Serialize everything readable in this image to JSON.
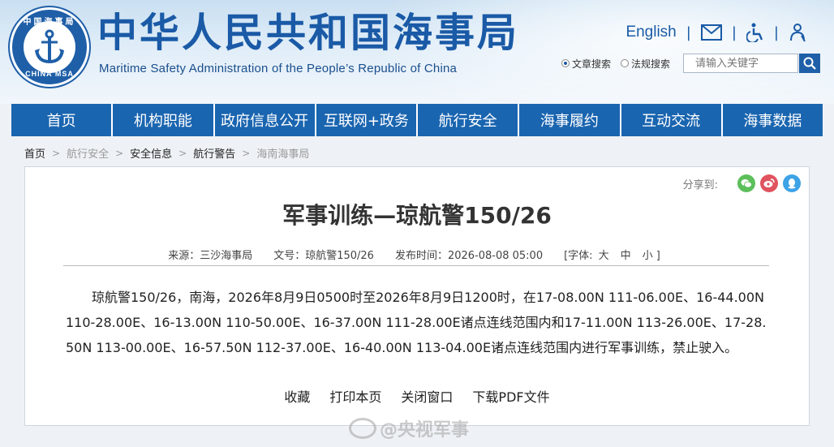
{
  "header": {
    "logo_top_text": "中国海事局",
    "logo_bottom_text": "CHINA MSA",
    "title": "中华人民共和国海事局",
    "subtitle": "Maritime Safety Administration of the People’s Republic of China",
    "english_link": "English",
    "search": {
      "option_article": "文章搜索",
      "option_law": "法规搜索",
      "placeholder": "请输入关键字"
    }
  },
  "nav": {
    "items": [
      "首页",
      "机构职能",
      "政府信息公开",
      "互联网+政务",
      "航行安全",
      "海事履约",
      "互动交流",
      "海事数据"
    ]
  },
  "breadcrumb": {
    "items": [
      "首页",
      "航行安全",
      "安全信息",
      "航行警告",
      "海南海事局"
    ],
    "separator": ">"
  },
  "article": {
    "share_label": "分享到:",
    "title": "军事训练—琼航警150/26",
    "meta": {
      "source": "来源：三沙海事局",
      "doc_no": "文号：琼航警150/26",
      "published": "发布时间：2026-08-08 05:00",
      "font_label": "[字体:",
      "font_large": "大",
      "font_medium": "中",
      "font_small": "小 ]"
    },
    "body": "琼航警150/26，南海，2026年8月9日0500时至2026年8月9日1200时，在17-08.00N 111-06.00E、16-44.00N 110-28.00E、16-13.00N 110-50.00E、16-37.00N 111-28.00E诸点连线范围内和17-11.00N 113-26.00E、17-28.50N 113-00.00E、16-57.50N 112-37.00E、16-40.00N 113-04.00E诸点连线范围内进行军事训练，禁止驶入。",
    "actions": [
      "收藏",
      "打印本页",
      "关闭窗口",
      "下载PDF文件"
    ]
  },
  "watermark": "@央视军事",
  "colors": {
    "brand_blue": "#1a65b0",
    "title_blue": "#1a5aa6",
    "wechat_green": "#5cbf5a",
    "weibo_red": "#e0545f",
    "qq_blue": "#3ea3e6"
  }
}
